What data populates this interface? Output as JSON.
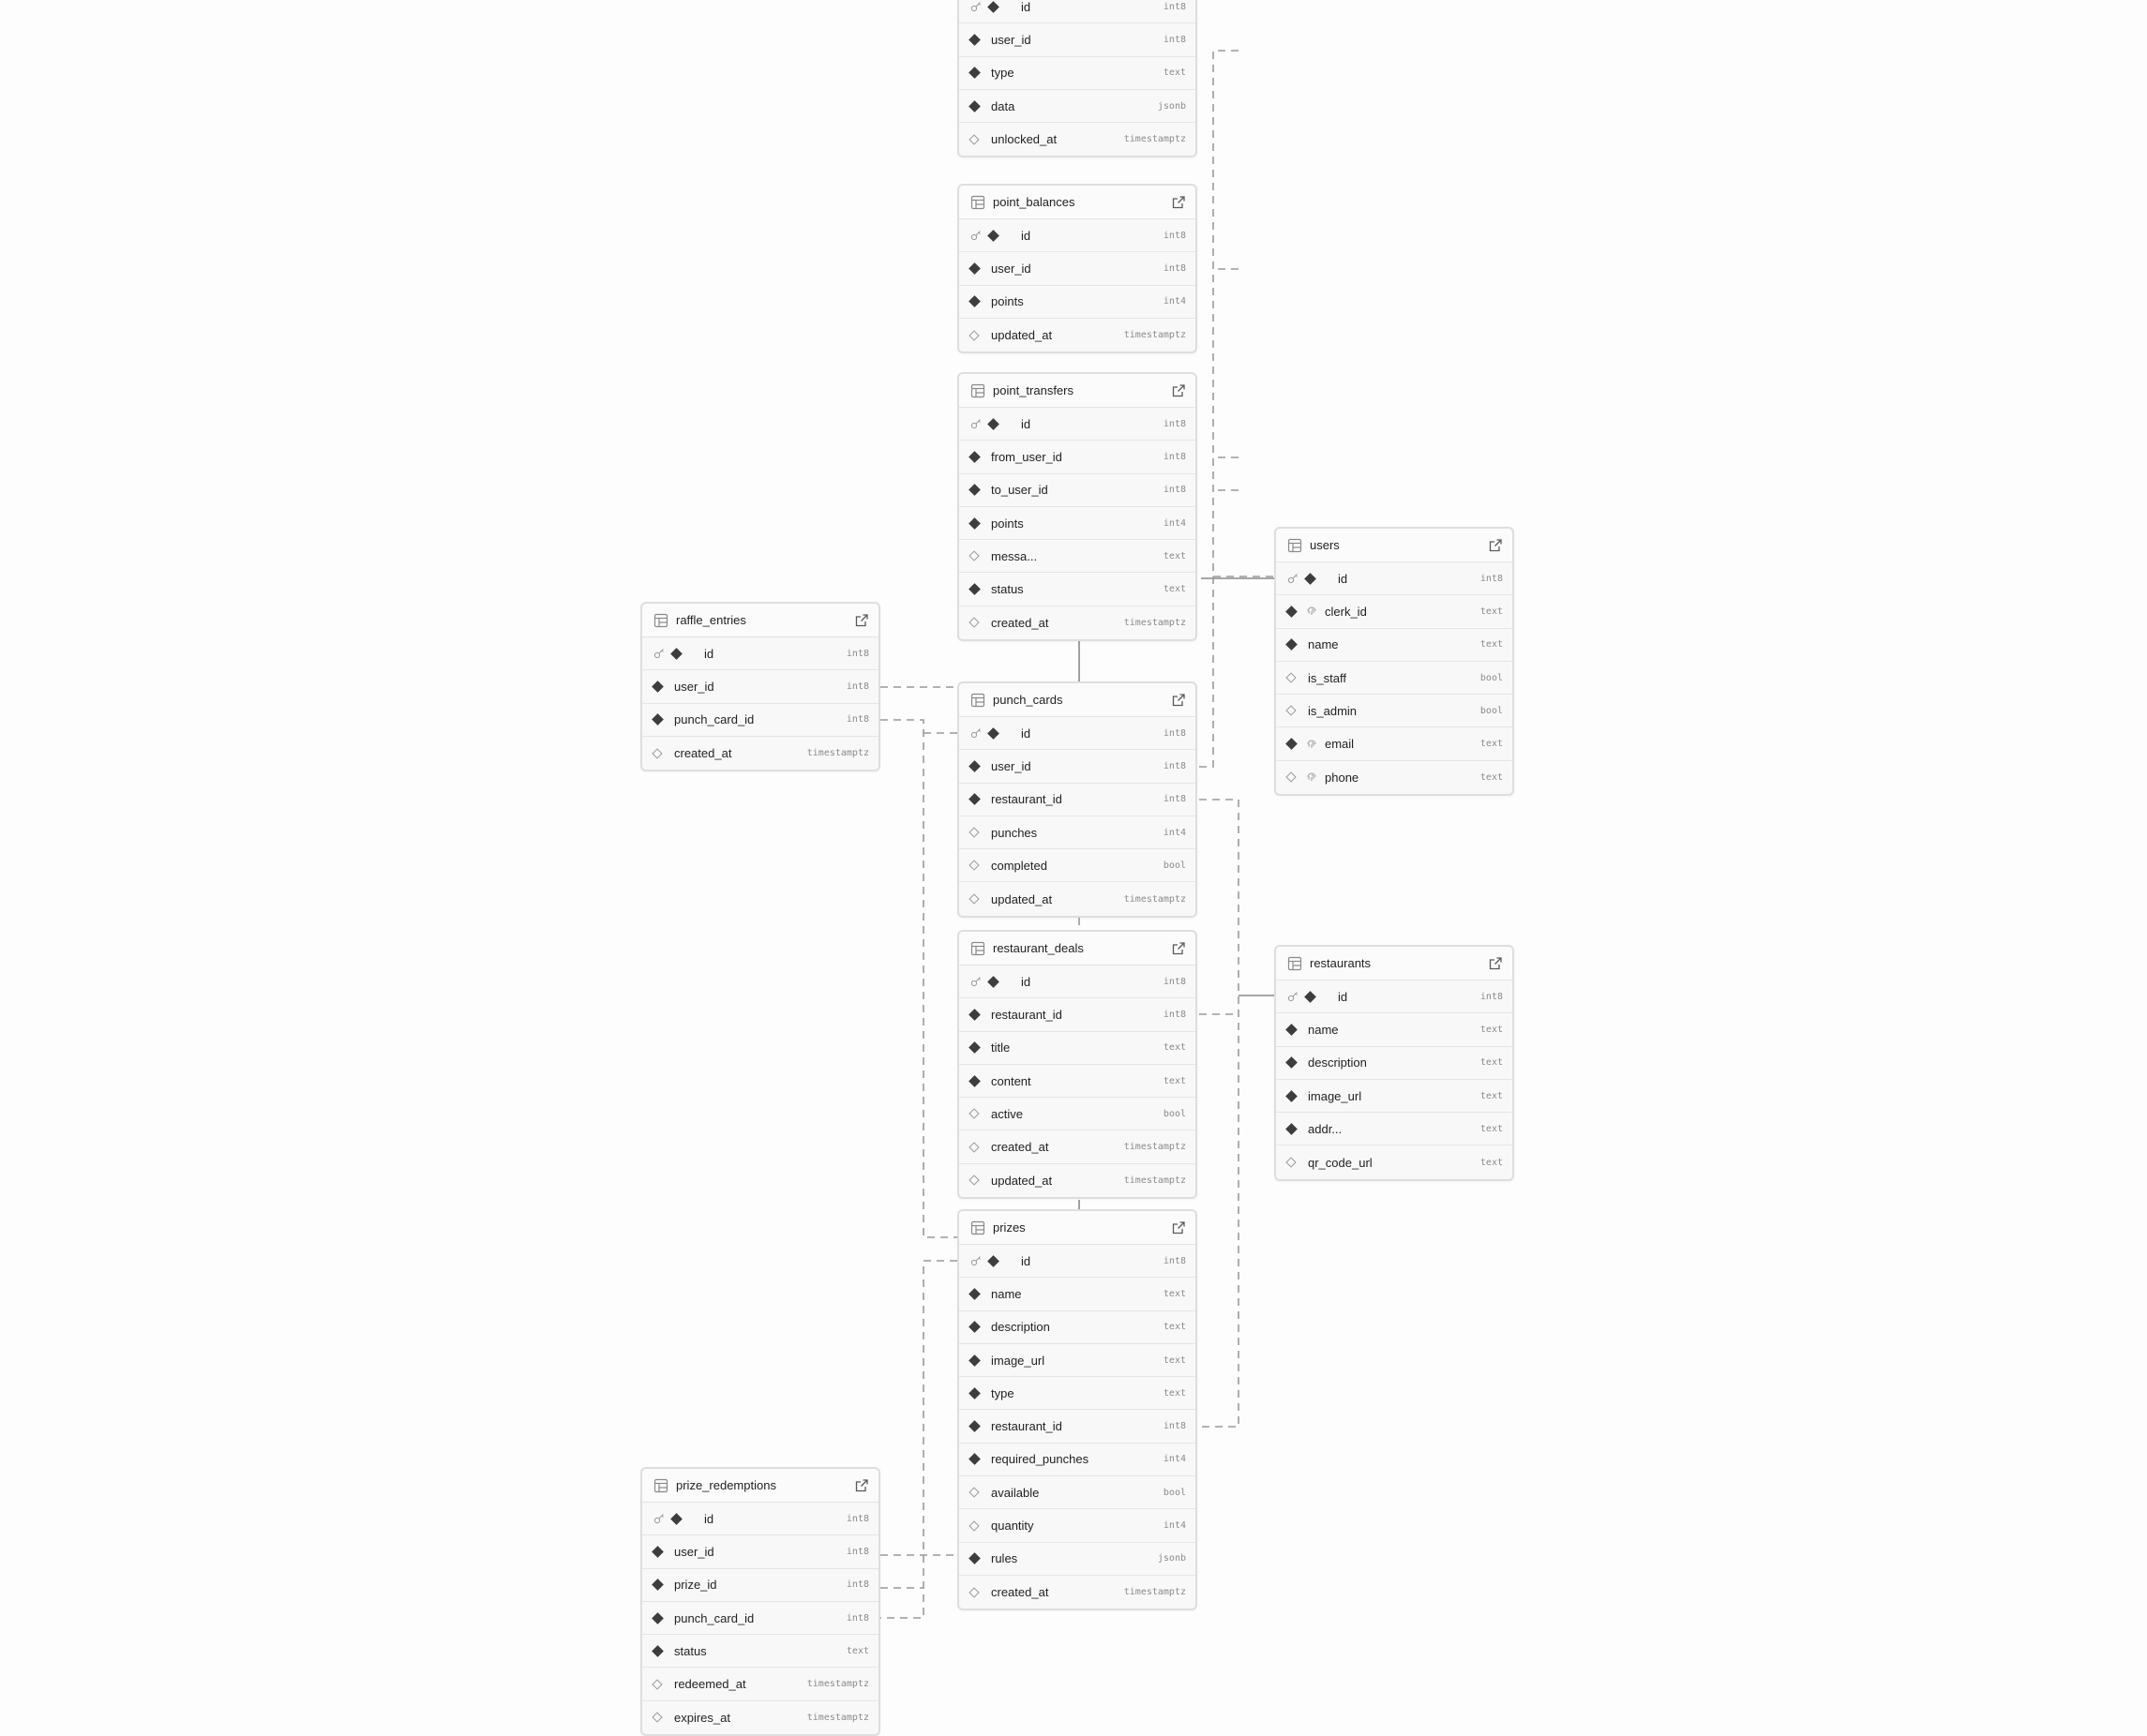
{
  "tables": [
    {
      "name": "",
      "headerVisible": false,
      "columns": [
        {
          "name": "id",
          "type": "int8",
          "pk": true,
          "nullable": false
        },
        {
          "name": "user_id",
          "type": "int8",
          "nullable": false
        },
        {
          "name": "type",
          "type": "text",
          "nullable": false
        },
        {
          "name": "data",
          "type": "jsonb",
          "nullable": false
        },
        {
          "name": "unlocked_at",
          "type": "timestamptz",
          "nullable": true
        }
      ]
    },
    {
      "name": "point_balances",
      "headerVisible": true,
      "columns": [
        {
          "name": "id",
          "type": "int8",
          "pk": true,
          "nullable": false
        },
        {
          "name": "user_id",
          "type": "int8",
          "nullable": false
        },
        {
          "name": "points",
          "type": "int4",
          "nullable": false
        },
        {
          "name": "updated_at",
          "type": "timestamptz",
          "nullable": true
        }
      ]
    },
    {
      "name": "point_transfers",
      "headerVisible": true,
      "columns": [
        {
          "name": "id",
          "type": "int8",
          "pk": true,
          "nullable": false
        },
        {
          "name": "from_user_id",
          "type": "int8",
          "nullable": false
        },
        {
          "name": "to_user_id",
          "type": "int8",
          "nullable": false
        },
        {
          "name": "points",
          "type": "int4",
          "nullable": false
        },
        {
          "name": "messa...",
          "type": "text",
          "nullable": true
        },
        {
          "name": "status",
          "type": "text",
          "nullable": false
        },
        {
          "name": "created_at",
          "type": "timestamptz",
          "nullable": true
        }
      ]
    },
    {
      "name": "users",
      "headerVisible": true,
      "columns": [
        {
          "name": "id",
          "type": "int8",
          "pk": true,
          "nullable": false
        },
        {
          "name": "clerk_id",
          "type": "text",
          "unique": true,
          "nullable": false
        },
        {
          "name": "name",
          "type": "text",
          "nullable": false
        },
        {
          "name": "is_staff",
          "type": "bool",
          "nullable": true
        },
        {
          "name": "is_admin",
          "type": "bool",
          "nullable": true
        },
        {
          "name": "email",
          "type": "text",
          "unique": true,
          "nullable": false
        },
        {
          "name": "phone",
          "type": "text",
          "unique": true,
          "nullable": true
        }
      ]
    },
    {
      "name": "raffle_entries",
      "headerVisible": true,
      "columns": [
        {
          "name": "id",
          "type": "int8",
          "pk": true,
          "nullable": false
        },
        {
          "name": "user_id",
          "type": "int8",
          "nullable": false
        },
        {
          "name": "punch_card_id",
          "type": "int8",
          "nullable": false
        },
        {
          "name": "created_at",
          "type": "timestamptz",
          "nullable": true
        }
      ]
    },
    {
      "name": "punch_cards",
      "headerVisible": true,
      "columns": [
        {
          "name": "id",
          "type": "int8",
          "pk": true,
          "nullable": false
        },
        {
          "name": "user_id",
          "type": "int8",
          "nullable": false
        },
        {
          "name": "restaurant_id",
          "type": "int8",
          "nullable": false
        },
        {
          "name": "punches",
          "type": "int4",
          "nullable": true
        },
        {
          "name": "completed",
          "type": "bool",
          "nullable": true
        },
        {
          "name": "updated_at",
          "type": "timestamptz",
          "nullable": true
        }
      ]
    },
    {
      "name": "restaurant_deals",
      "headerVisible": true,
      "columns": [
        {
          "name": "id",
          "type": "int8",
          "pk": true,
          "nullable": false
        },
        {
          "name": "restaurant_id",
          "type": "int8",
          "nullable": false
        },
        {
          "name": "title",
          "type": "text",
          "nullable": false
        },
        {
          "name": "content",
          "type": "text",
          "nullable": false
        },
        {
          "name": "active",
          "type": "bool",
          "nullable": true
        },
        {
          "name": "created_at",
          "type": "timestamptz",
          "nullable": true
        },
        {
          "name": "updated_at",
          "type": "timestamptz",
          "nullable": true
        }
      ]
    },
    {
      "name": "restaurants",
      "headerVisible": true,
      "columns": [
        {
          "name": "id",
          "type": "int8",
          "pk": true,
          "nullable": false
        },
        {
          "name": "name",
          "type": "text",
          "nullable": false
        },
        {
          "name": "description",
          "type": "text",
          "nullable": false
        },
        {
          "name": "image_url",
          "type": "text",
          "nullable": false
        },
        {
          "name": "addr...",
          "type": "text",
          "nullable": false
        },
        {
          "name": "qr_code_url",
          "type": "text",
          "nullable": true
        }
      ]
    },
    {
      "name": "prizes",
      "headerVisible": true,
      "columns": [
        {
          "name": "id",
          "type": "int8",
          "pk": true,
          "nullable": false
        },
        {
          "name": "name",
          "type": "text",
          "nullable": false
        },
        {
          "name": "description",
          "type": "text",
          "nullable": false
        },
        {
          "name": "image_url",
          "type": "text",
          "nullable": false
        },
        {
          "name": "type",
          "type": "text",
          "nullable": false
        },
        {
          "name": "restaurant_id",
          "type": "int8",
          "nullable": false
        },
        {
          "name": "required_punches",
          "type": "int4",
          "nullable": false
        },
        {
          "name": "available",
          "type": "bool",
          "nullable": true
        },
        {
          "name": "quantity",
          "type": "int4",
          "nullable": true
        },
        {
          "name": "rules",
          "type": "jsonb",
          "nullable": false
        },
        {
          "name": "created_at",
          "type": "timestamptz",
          "nullable": true
        }
      ]
    },
    {
      "name": "prize_redemptions",
      "headerVisible": true,
      "columns": [
        {
          "name": "id",
          "type": "int8",
          "pk": true,
          "nullable": false
        },
        {
          "name": "user_id",
          "type": "int8",
          "nullable": false
        },
        {
          "name": "prize_id",
          "type": "int8",
          "nullable": false
        },
        {
          "name": "punch_card_id",
          "type": "int8",
          "nullable": false
        },
        {
          "name": "status",
          "type": "text",
          "nullable": false
        },
        {
          "name": "redeemed_at",
          "type": "timestamptz",
          "nullable": true
        },
        {
          "name": "expires_at",
          "type": "timestamptz",
          "nullable": true
        }
      ]
    }
  ]
}
